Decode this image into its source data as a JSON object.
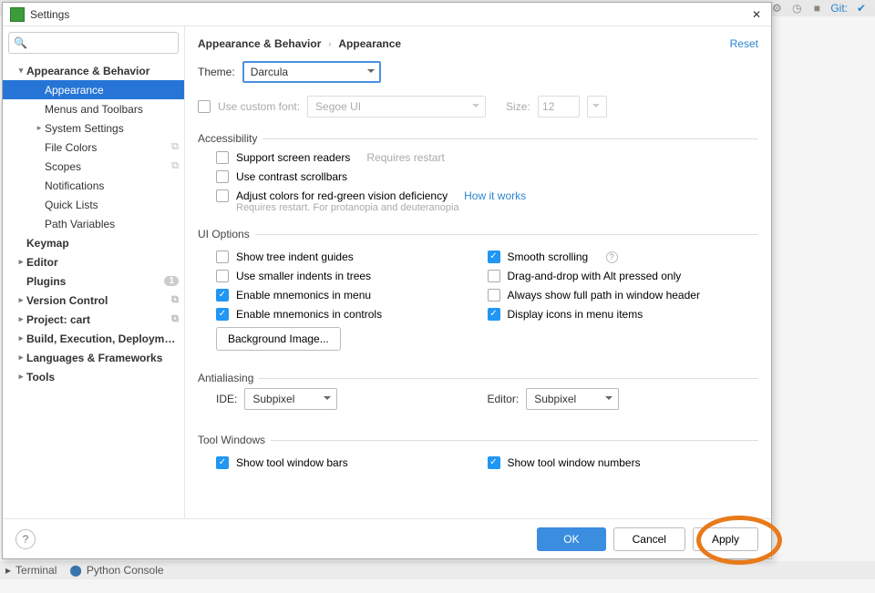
{
  "toolbar": {
    "git_label": "Git:"
  },
  "dialog": {
    "title": "Settings",
    "reset": "Reset",
    "breadcrumb": [
      "Appearance & Behavior",
      "Appearance"
    ],
    "footer": {
      "ok": "OK",
      "cancel": "Cancel",
      "apply": "Apply",
      "help": "?"
    }
  },
  "search": {
    "placeholder": ""
  },
  "sidebar": [
    {
      "label": "Appearance & Behavior",
      "depth": 1,
      "bold": true,
      "chev": "v"
    },
    {
      "label": "Appearance",
      "depth": 2,
      "selected": true
    },
    {
      "label": "Menus and Toolbars",
      "depth": 2
    },
    {
      "label": "System Settings",
      "depth": 2,
      "chev": ">"
    },
    {
      "label": "File Colors",
      "depth": 2,
      "badge": true
    },
    {
      "label": "Scopes",
      "depth": 2,
      "badge": true
    },
    {
      "label": "Notifications",
      "depth": 2
    },
    {
      "label": "Quick Lists",
      "depth": 2
    },
    {
      "label": "Path Variables",
      "depth": 2
    },
    {
      "label": "Keymap",
      "depth": 1,
      "bold": true
    },
    {
      "label": "Editor",
      "depth": 1,
      "bold": true,
      "chev": ">"
    },
    {
      "label": "Plugins",
      "depth": 1,
      "bold": true,
      "count": "1"
    },
    {
      "label": "Version Control",
      "depth": 1,
      "bold": true,
      "chev": ">",
      "badge": true
    },
    {
      "label": "Project: cart",
      "depth": 1,
      "bold": true,
      "chev": ">",
      "badge": true
    },
    {
      "label": "Build, Execution, Deployment",
      "depth": 1,
      "bold": true,
      "chev": ">"
    },
    {
      "label": "Languages & Frameworks",
      "depth": 1,
      "bold": true,
      "chev": ">"
    },
    {
      "label": "Tools",
      "depth": 1,
      "bold": true,
      "chev": ">"
    }
  ],
  "appearance": {
    "theme_label": "Theme:",
    "theme_value": "Darcula",
    "use_custom_font": "Use custom font:",
    "font_value": "Segoe UI",
    "size_label": "Size:",
    "size_value": "12",
    "accessibility": {
      "title": "Accessibility",
      "screen_readers": "Support screen readers",
      "requires_restart": "Requires restart",
      "contrast_scrollbars": "Use contrast scrollbars",
      "color_deficiency": "Adjust colors for red-green vision deficiency",
      "how_it_works": "How it works",
      "restart_note": "Requires restart. For protanopia and deuteranopia"
    },
    "ui_options": {
      "title": "UI Options",
      "tree_indent": "Show tree indent guides",
      "smooth_scroll": "Smooth scrolling",
      "smaller_indents": "Use smaller indents in trees",
      "drag_alt": "Drag-and-drop with Alt pressed only",
      "mnemonics_menu": "Enable mnemonics in menu",
      "full_path": "Always show full path in window header",
      "mnemonics_controls": "Enable mnemonics in controls",
      "display_icons": "Display icons in menu items",
      "bg_image": "Background Image..."
    },
    "antialiasing": {
      "title": "Antialiasing",
      "ide_label": "IDE:",
      "ide_value": "Subpixel",
      "editor_label": "Editor:",
      "editor_value": "Subpixel"
    },
    "tool_windows": {
      "title": "Tool Windows",
      "show_bars": "Show tool window bars",
      "show_numbers": "Show tool window numbers"
    }
  },
  "bottom_tabs": {
    "terminal": "Terminal",
    "python_console": "Python Console"
  }
}
